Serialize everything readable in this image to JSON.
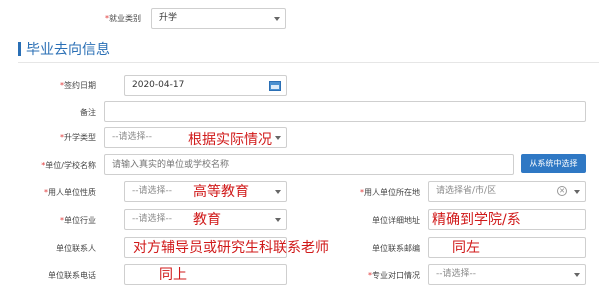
{
  "employment": {
    "label": "就业类别",
    "value": "升学"
  },
  "section": {
    "title": "毕业去向信息"
  },
  "fields": {
    "sign_date": {
      "label": "签约日期",
      "value": "2020-04-17"
    },
    "remark": {
      "label": "备注",
      "value": ""
    },
    "study_type": {
      "label": "升学类型",
      "value": "--请选择--"
    },
    "unit_school": {
      "label": "单位/学校名称",
      "placeholder": "请输入真实的单位或学校名称",
      "button": "从系统中选择"
    },
    "unit_nature": {
      "label": "用人单位性质",
      "value": "--请选择--"
    },
    "unit_location": {
      "label": "用人单位所在地",
      "placeholder": "请选择省/市/区"
    },
    "industry": {
      "label": "单位行业",
      "value": "--请选择--"
    },
    "address": {
      "label": "单位详细地址",
      "value": ""
    },
    "contact": {
      "label": "单位联系人",
      "value": ""
    },
    "postcode": {
      "label": "单位联系邮编",
      "value": ""
    },
    "phone": {
      "label": "单位联系电话",
      "value": ""
    },
    "major_match": {
      "label": "专业对口情况",
      "value": "--请选择--"
    }
  },
  "annotations": {
    "study_type": "根据实际情况",
    "unit_nature": "高等教育",
    "industry": "教育",
    "address": "精确到学院/系",
    "contact": "对方辅导员或研究生科联系老师",
    "postcode": "同左",
    "phone": "同上"
  },
  "colors": {
    "accent": "#2a6fb5",
    "required": "#e03b3b",
    "annotation": "#d01919",
    "button": "#2f78c4"
  }
}
